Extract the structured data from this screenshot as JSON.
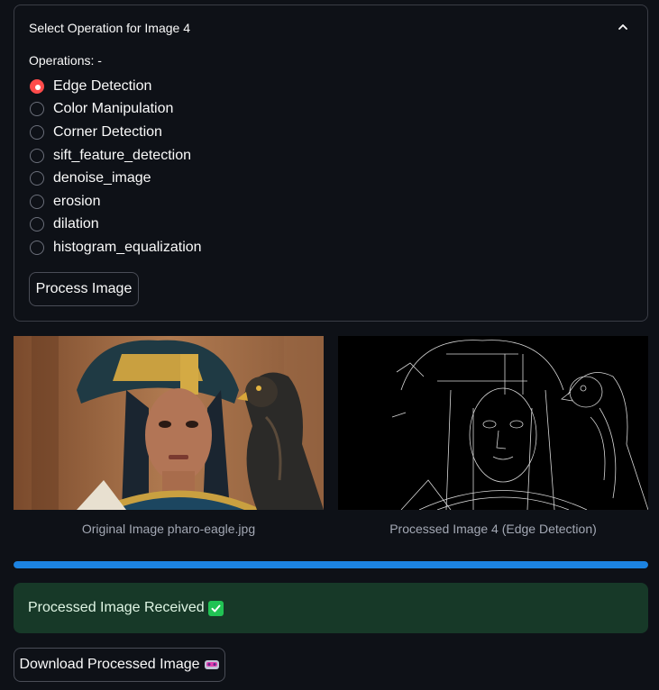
{
  "expander": {
    "title": "Select Operation for Image 4",
    "chevron_icon": "chevron-up-icon"
  },
  "operations": {
    "label": "Operations: -",
    "selected": "Edge Detection",
    "options": [
      "Edge Detection",
      "Color Manipulation",
      "Corner Detection",
      "sift_feature_detection",
      "denoise_image",
      "erosion",
      "dilation",
      "histogram_equalization"
    ]
  },
  "process_button": {
    "label": "Process Image"
  },
  "images": {
    "original_caption": "Original Image pharo-eagle.jpg",
    "processed_caption": "Processed Image 4 (Edge Detection)"
  },
  "progress": {
    "percent": 100
  },
  "alert": {
    "text": "Processed Image Received",
    "icon": "check-mark-button-icon"
  },
  "download_button": {
    "label": "Download Processed Image",
    "icon": "vr-headset-icon"
  },
  "colors": {
    "background": "#0e1117",
    "accent_red": "#ff4b4b",
    "progress_blue": "#1c83e1",
    "success_bg": "#173928"
  }
}
